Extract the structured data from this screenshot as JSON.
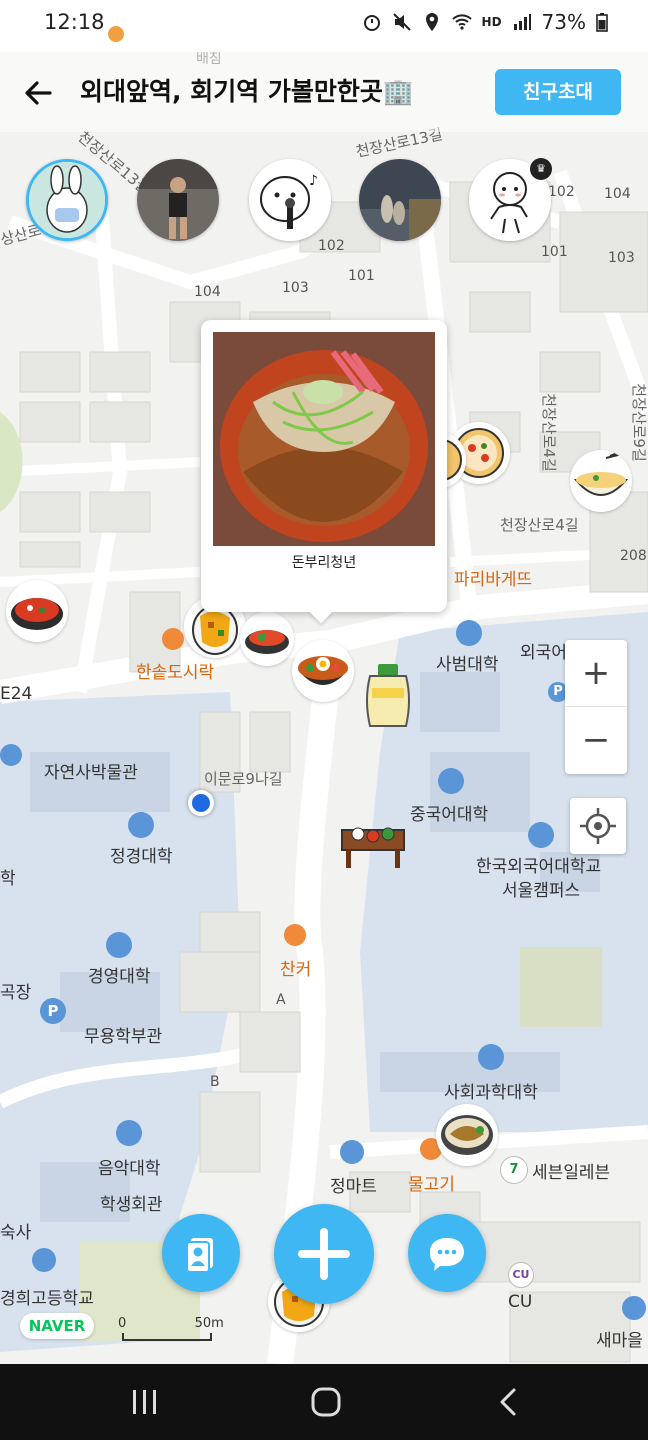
{
  "status_bar": {
    "time": "12:18",
    "battery": "73%",
    "network": "HD"
  },
  "header": {
    "title": "외대앞역, 회기역 가볼만한곳🏢",
    "invite_label": "친구초대"
  },
  "friends": [
    {
      "name": "friend-1",
      "active": true
    },
    {
      "name": "friend-2",
      "active": false
    },
    {
      "name": "friend-3",
      "active": false
    },
    {
      "name": "friend-4",
      "active": false
    },
    {
      "name": "friend-5",
      "active": false,
      "owner": true
    }
  ],
  "popup": {
    "place_name": "돈부리청년"
  },
  "map_labels": {
    "roads": [
      "천장산로13길",
      "천장산로13길",
      "천장산로4길",
      "천장산로4길",
      "천장산로",
      "이문로9나길",
      "천장산로9길"
    ],
    "buildings": [
      "102",
      "104",
      "102",
      "101",
      "103",
      "104",
      "103",
      "101",
      "208"
    ],
    "places_orange": [
      "한솥도시락",
      "파리바게뜨",
      "찬커",
      "물고기"
    ],
    "places": [
      "사범대학",
      "외국어",
      "자연사박물관",
      "정경대학",
      "중국어대학",
      "한국외국어대학교",
      "서울캠퍼스",
      "경영대학",
      "무용학부관",
      "사회과학대학",
      "정마트",
      "세븐일레븐",
      "음악대학",
      "학생회관",
      "경희고등학교",
      "CU",
      "새마을",
      "E24",
      "학",
      "곡장",
      "숙사",
      "A",
      "B",
      "배침",
      "상산로"
    ]
  },
  "controls": {
    "zoom_in": "+",
    "zoom_out": "−"
  },
  "naver_logo": "NAVER",
  "scale": {
    "zero": "0",
    "distance": "50m"
  },
  "colors": {
    "accent": "#3fb7f2",
    "orange_label": "#d9660f",
    "campus": "#d8e2ee"
  }
}
